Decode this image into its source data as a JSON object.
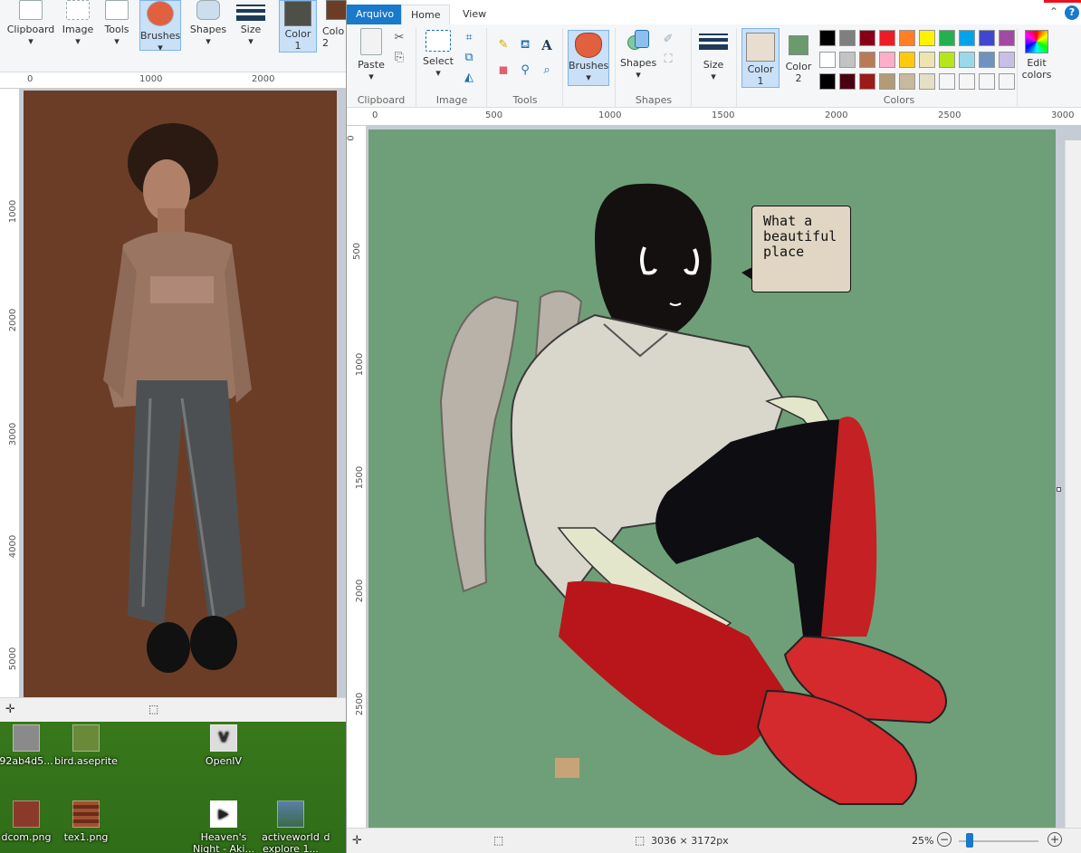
{
  "desktop": {
    "icons": [
      {
        "name": "92ab4d5...",
        "kind": "image"
      },
      {
        "name": "bird.aseprite",
        "kind": "aseprite"
      },
      {
        "name": "OpenIV",
        "kind": "app"
      },
      {
        "name": "dcom.png",
        "kind": "image"
      },
      {
        "name": "tex1.png",
        "kind": "image"
      },
      {
        "name": "Heaven's Night - Aki...",
        "kind": "video"
      },
      {
        "name": "activeworld explore 1...",
        "kind": "image"
      },
      {
        "name": "d",
        "kind": "image"
      }
    ]
  },
  "left_window": {
    "ribbon": {
      "clipboard": "Clipboard",
      "image": "Image",
      "tools": "Tools",
      "brushes": "Brushes",
      "shapes": "Shapes",
      "size": "Size",
      "color1": "Color\n1",
      "color2": "Colo\n2"
    },
    "ruler_h": [
      "0",
      "1000",
      "2000"
    ],
    "ruler_v": [
      "1000",
      "2000",
      "3000",
      "4000",
      "5000"
    ],
    "canvas_bg": "#6b3d27"
  },
  "right_window": {
    "tabs": {
      "file": "Arquivo",
      "home": "Home",
      "view": "View"
    },
    "ribbon": {
      "clipboard": {
        "paste": "Paste",
        "label": "Clipboard"
      },
      "image": {
        "select": "Select",
        "label": "Image"
      },
      "tools": {
        "label": "Tools"
      },
      "brushes": {
        "label": "Brushes"
      },
      "shapes": {
        "shapes": "Shapes",
        "label": "Shapes"
      },
      "size": {
        "label": "Size"
      },
      "color1": {
        "label": "Color\n1",
        "value": "#e8ded0"
      },
      "color2": {
        "label": "Color\n2",
        "value": "#6b9a6e"
      },
      "colors": {
        "label": "Colors"
      },
      "edit_colors": "Edit\ncolors"
    },
    "palette": [
      [
        "#000000",
        "#7f7f7f",
        "#880015",
        "#ed1c24",
        "#ff7f27",
        "#fff200",
        "#22b14c",
        "#00a2e8",
        "#3f48cc",
        "#a349a4"
      ],
      [
        "#ffffff",
        "#c3c3c3",
        "#b97a57",
        "#ffaec9",
        "#ffc90e",
        "#efe4b0",
        "#b5e61d",
        "#99d9ea",
        "#7092be",
        "#c8bfe7"
      ],
      [
        "#000000",
        "#4a0010",
        "#9b1b1b",
        "#b39b77",
        "#c6b99d",
        "#e6dfc8",
        "#f5f5f5",
        "#f5f5f5",
        "#f5f5f5",
        "#f5f5f5"
      ]
    ],
    "ruler_h": [
      "0",
      "500",
      "1000",
      "1500",
      "2000",
      "2500",
      "3000"
    ],
    "ruler_v": [
      "0",
      "500",
      "1000",
      "1500",
      "2000",
      "2500"
    ],
    "canvas_bg": "#6f9f78",
    "speech_bubble": "What a\nbeautiful\nplace",
    "status": {
      "dimensions": "3036 × 3172px",
      "zoom": "25%"
    }
  }
}
